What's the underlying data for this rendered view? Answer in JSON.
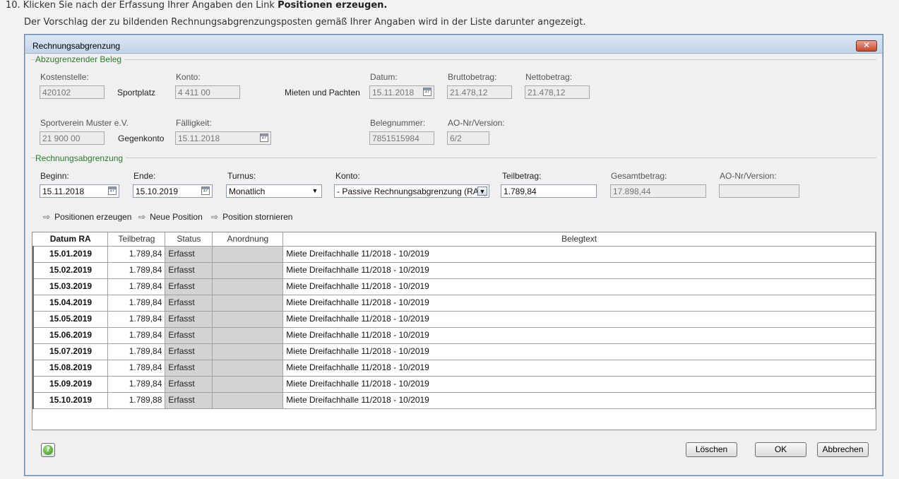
{
  "instructions": {
    "step_prefix": "10.  Klicken Sie nach der Erfassung Ihrer Angaben den Link ",
    "step_bold": "Positionen erzeugen.",
    "line2": "Der Vorschlag der zu bildenden Rechnungsabgrenzungsposten gemäß Ihrer Angaben wird in der Liste darunter angezeigt."
  },
  "dialog": {
    "title": "Rechnungsabgrenzung",
    "close_symbol": "✕"
  },
  "beleg": {
    "group_title": "Abzugrenzender Beleg",
    "kostenstelle_label": "Kostenstelle:",
    "kostenstelle_value": "420102",
    "kostenstelle_name": "Sportplatz",
    "konto_label": "Konto:",
    "konto_value": "4 411 00",
    "konto_name": "Mieten und Pachten",
    "datum_label": "Datum:",
    "datum_value": "15.11.2018",
    "brutto_label": "Bruttobetrag:",
    "brutto_value": "21.478,12",
    "netto_label": "Nettobetrag:",
    "netto_value": "21.478,12",
    "partner_label": "Sportverein Muster e.V.",
    "partner_value": "21 900 00",
    "gegenkonto_label": "Gegenkonto",
    "faelligkeit_label": "Fälligkeit:",
    "faelligkeit_value": "15.11.2018",
    "belegnummer_label": "Belegnummer:",
    "belegnummer_value": "7851515984",
    "ao_label": "AO-Nr/Version:",
    "ao_value": "6/2",
    "cal_symbol": "17"
  },
  "abgrenzung": {
    "group_title": "Rechnungsabgrenzung",
    "beginn_label": "Beginn:",
    "beginn_value": "15.11.2018",
    "ende_label": "Ende:",
    "ende_value": "15.10.2019",
    "turnus_label": "Turnus:",
    "turnus_value": "Monatlich",
    "konto_label": "Konto:",
    "konto_value": "- Passive Rechnungsabgrenzung (RAP)",
    "teilbetrag_label": "Teilbetrag:",
    "teilbetrag_value": "1.789,84",
    "gesamt_label": "Gesamtbetrag:",
    "gesamt_value": "17.898,44",
    "ao_label": "AO-Nr/Version:",
    "ao_value": ""
  },
  "links": {
    "arrow_symbol": "⇨",
    "erzeugen": "Positionen erzeugen",
    "neu": "Neue Position",
    "stornieren": "Position stornieren"
  },
  "table": {
    "headers": [
      "Datum RA",
      "Teilbetrag",
      "Status",
      "Anordnung",
      "Belegtext"
    ],
    "rows": [
      {
        "datum": "15.01.2019",
        "betrag": "1.789,84",
        "status": "Erfasst",
        "anordnung": "",
        "text": "Miete Dreifachhalle 11/2018 - 10/2019"
      },
      {
        "datum": "15.02.2019",
        "betrag": "1.789,84",
        "status": "Erfasst",
        "anordnung": "",
        "text": "Miete Dreifachhalle 11/2018 - 10/2019"
      },
      {
        "datum": "15.03.2019",
        "betrag": "1.789,84",
        "status": "Erfasst",
        "anordnung": "",
        "text": "Miete Dreifachhalle 11/2018 - 10/2019"
      },
      {
        "datum": "15.04.2019",
        "betrag": "1.789,84",
        "status": "Erfasst",
        "anordnung": "",
        "text": "Miete Dreifachhalle 11/2018 - 10/2019"
      },
      {
        "datum": "15.05.2019",
        "betrag": "1.789,84",
        "status": "Erfasst",
        "anordnung": "",
        "text": "Miete Dreifachhalle 11/2018 - 10/2019"
      },
      {
        "datum": "15.06.2019",
        "betrag": "1.789,84",
        "status": "Erfasst",
        "anordnung": "",
        "text": "Miete Dreifachhalle 11/2018 - 10/2019"
      },
      {
        "datum": "15.07.2019",
        "betrag": "1.789,84",
        "status": "Erfasst",
        "anordnung": "",
        "text": "Miete Dreifachhalle 11/2018 - 10/2019"
      },
      {
        "datum": "15.08.2019",
        "betrag": "1.789,84",
        "status": "Erfasst",
        "anordnung": "",
        "text": "Miete Dreifachhalle 11/2018 - 10/2019"
      },
      {
        "datum": "15.09.2019",
        "betrag": "1.789,84",
        "status": "Erfasst",
        "anordnung": "",
        "text": "Miete Dreifachhalle 11/2018 - 10/2019"
      },
      {
        "datum": "15.10.2019",
        "betrag": "1.789,88",
        "status": "Erfasst",
        "anordnung": "",
        "text": "Miete Dreifachhalle 11/2018 - 10/2019"
      }
    ]
  },
  "footer": {
    "help_symbol": "?",
    "loeschen": "Löschen",
    "ok": "OK",
    "abbrechen": "Abbrechen"
  }
}
